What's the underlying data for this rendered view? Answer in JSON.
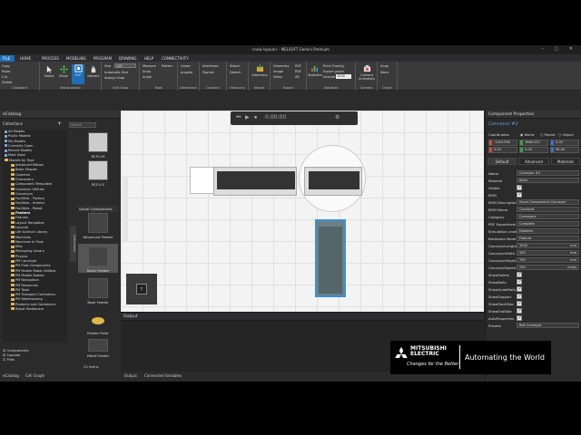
{
  "window": {
    "title": "<new layout> - MELSOFT Gemini Premium"
  },
  "menu": [
    "FILE",
    "HOME",
    "PROCESS",
    "MODELING",
    "PROGRAM",
    "DRAWING",
    "HELP",
    "CONNECTIVITY"
  ],
  "ribbon": {
    "clipboard": {
      "label": "Clipboard",
      "copy": "Copy",
      "paste": "Paste",
      "cut": "Cut",
      "delete": "Delete"
    },
    "manipulation": {
      "label": "Manipulation",
      "select": "Select",
      "move": "Move",
      "ppp": "PnP",
      "interact": "Interact"
    },
    "grid_snap": {
      "label": "Grid Snap",
      "size_label": "Size",
      "size_value": "100",
      "auto_size": "Automatic Size",
      "always_snap": "Always Snap"
    },
    "tools": {
      "label": "Tools",
      "measure": "Measure",
      "snap": "Snap",
      "angle": "Angle",
      "pattern": "Pattern"
    },
    "dimension": {
      "label": "Dimension",
      "linear": "Linear",
      "angular": "Angular"
    },
    "connect": {
      "label": "Connect",
      "interfaces": "Interfaces",
      "signals": "Signals"
    },
    "hierarchy": {
      "label": "Hierarchy",
      "attach": "Attach",
      "detach": "Detach"
    },
    "import": {
      "label": "Import",
      "geometry": "Geometry"
    },
    "export": {
      "label": "Export",
      "geometry": "Geometry",
      "image": "Image",
      "video": "Video",
      "pdf": "PDF",
      "pdf3d": "PDF",
      "ar": "AR"
    },
    "statistics": {
      "label": "Statistics",
      "statistics": "Statistics",
      "print_chart": "Print Chart(s)",
      "export_graph": "Export graph",
      "interval_label": "Interval",
      "interval_value": "1000"
    },
    "camera": {
      "label": "Camera",
      "camera_animation": "Camera Animation"
    },
    "origin": {
      "label": "Origin",
      "snap": "Snap",
      "move": "Move"
    }
  },
  "catalog": {
    "title": "eCatalog",
    "section_label": "Collections",
    "search_placeholder": "Search",
    "tree": [
      "All Models",
      "Public Models",
      "My Models",
      "Currently Open",
      "Recent Models",
      "Most Used",
      "Models by Type",
      "Advanced Motion",
      "Basic Shapes",
      "Cameras",
      "Characters",
      "Component Templates",
      "Conveyor Utilities",
      "Conveyors",
      "Facilities - Factory",
      "Facilities - Interior",
      "Facilities - Robot",
      "Feeders",
      "Fixtures",
      "Layout Templates",
      "Layouts",
      "Life Science Library",
      "Machines",
      "Machines in Flow",
      "Misc",
      "Packaging Library",
      "Physics",
      "PM Conveyor",
      "PM Flow Components",
      "PM Mobile Robot Utilities",
      "PM Mobile Robots",
      "PM Navigation",
      "PM Resources",
      "PM Tools",
      "PM Transport Controllers",
      "PM Warehousing",
      "Products and Containers",
      "Robot Positioners"
    ],
    "side_tab": "Collections",
    "gallery_top": [
      "RCFU-M",
      "RCFU-S"
    ],
    "gallery_header": "Visual Components",
    "gallery": [
      "Advanced Feeder",
      "Basic Feeder",
      "Bowl Feeder",
      "Feeder Point",
      "Pallet Feeder"
    ],
    "item_count": "20 Items",
    "bottom_checks": [
      "Components",
      "Layouts",
      "Files"
    ]
  },
  "viewport": {
    "time": "0:00:00"
  },
  "output": {
    "title": "Output"
  },
  "bottom_tabs": [
    "eCatalog",
    "Cell Graph",
    "Output",
    "Connected Variables"
  ],
  "properties": {
    "title": "Component Properties",
    "component_name": "Conveyor #2",
    "coordinates_label": "Coordinates",
    "coord_modes": [
      "World",
      "Parent",
      "Object"
    ],
    "coord_values": [
      "-1003.095",
      "1660.522",
      "0.00",
      "0.00",
      "0.00",
      "90.00"
    ],
    "tabs": [
      "Default",
      "Advanced",
      "Materials"
    ],
    "rows": [
      {
        "label": "Name",
        "value": "Conveyor #2"
      },
      {
        "label": "Material",
        "value": "black"
      },
      {
        "label": "Visible",
        "check": true
      },
      {
        "label": "BOM",
        "check": true
      },
      {
        "label": "BOM Description",
        "value": "Visual Components Conveyor"
      },
      {
        "label": "BOM Name",
        "value": "Conveyor"
      },
      {
        "label": "Category",
        "value": "Conveyors"
      },
      {
        "label": "PDF Exportlevel",
        "value": "Complete"
      },
      {
        "label": "Simulation Level",
        "value": "Detailed"
      },
      {
        "label": "Backbone Mode",
        "value": "Feature"
      },
      {
        "label": "ConveyorLength",
        "value": "1500",
        "unit": "mm"
      },
      {
        "label": "ConveyorWidth",
        "value": "500",
        "unit": "mm"
      },
      {
        "label": "ConveyorHeight",
        "value": "700",
        "unit": "mm"
      },
      {
        "label": "ConveyorSpeed",
        "value": "200",
        "unit": "mm/s"
      },
      {
        "label": "ShowRollers",
        "check": true
      },
      {
        "label": "ShowBelts",
        "check": true
      },
      {
        "label": "ShowGuideRails",
        "check": true
      },
      {
        "label": "ShowSupport",
        "check": true
      },
      {
        "label": "ShowStartSide",
        "check": true
      },
      {
        "label": "ShowEndSide",
        "check": true
      },
      {
        "label": "AutoProperties",
        "check": true
      },
      {
        "label": "Presets",
        "value": "Belt Conveyor"
      }
    ]
  },
  "branding": {
    "company_line1": "MITSUBISHI",
    "company_line2": "ELECTRIC",
    "tagline": "Changes for the Better",
    "slogan": "Automating the World"
  },
  "colors": {
    "accent": "#1e6fb5",
    "app_bg": "#2b2b2b",
    "viewport_bg": "#f3f3f3",
    "selection": "#2e8bd8"
  }
}
